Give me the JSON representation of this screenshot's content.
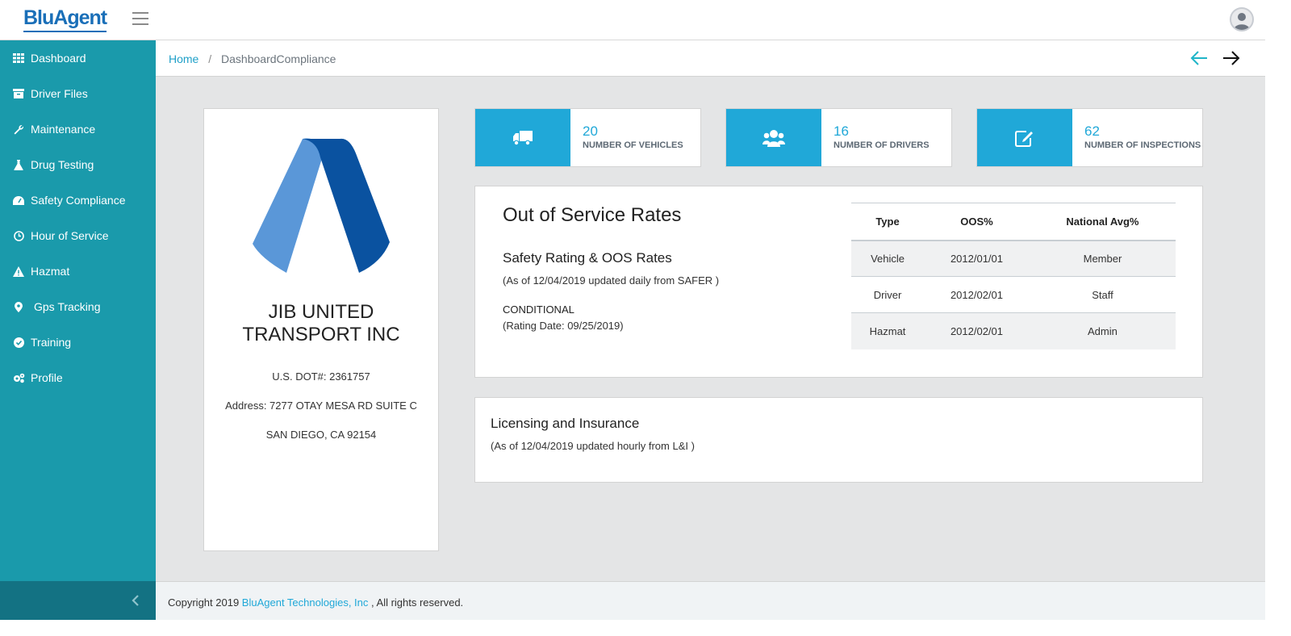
{
  "brand": {
    "logo_text": "BluAgent"
  },
  "sidebar": {
    "items": [
      {
        "label": "Dashboard",
        "icon": "grid-icon"
      },
      {
        "label": "Driver Files",
        "icon": "archive-icon"
      },
      {
        "label": "Maintenance",
        "icon": "wrench-icon"
      },
      {
        "label": "Drug Testing",
        "icon": "flask-icon"
      },
      {
        "label": "Safety Compliance",
        "icon": "gauge-icon"
      },
      {
        "label": "Hour of Service",
        "icon": "clock-icon"
      },
      {
        "label": "Hazmat",
        "icon": "warning-icon"
      },
      {
        "label": "Gps Tracking",
        "icon": "map-pin-icon"
      },
      {
        "label": "Training",
        "icon": "check-circle-icon"
      },
      {
        "label": "Profile",
        "icon": "cogs-icon"
      }
    ]
  },
  "breadcrumb": {
    "home": "Home",
    "separator": "/",
    "current": "DashboardCompliance"
  },
  "company": {
    "name_line1": "JIB UNITED",
    "name_line2": "TRANSPORT INC",
    "dot": "U.S. DOT#: 2361757",
    "address": "Address: 7277 OTAY MESA RD SUITE C",
    "city": "SAN DIEGO, CA 92154"
  },
  "stats": [
    {
      "value": "20",
      "label": "NUMBER OF VEHICLES",
      "icon": "truck-icon"
    },
    {
      "value": "16",
      "label": "NUMBER OF DRIVERS",
      "icon": "users-icon"
    },
    {
      "value": "62",
      "label": "NUMBER OF INSPECTIONS",
      "icon": "edit-icon"
    }
  ],
  "oos": {
    "title": "Out of Service Rates",
    "subtitle": "Safety Rating & OOS Rates",
    "note": "(As of 12/04/2019 updated daily from SAFER )",
    "rating": "CONDITIONAL",
    "rating_date": "(Rating Date: 09/25/2019)",
    "columns": [
      "Type",
      "OOS%",
      "National Avg%"
    ],
    "rows": [
      [
        "Vehicle",
        "2012/01/01",
        "Member"
      ],
      [
        "Driver",
        "2012/02/01",
        "Staff"
      ],
      [
        "Hazmat",
        "2012/02/01",
        "Admin"
      ]
    ]
  },
  "licensing": {
    "title": "Licensing and Insurance",
    "note": "(As of 12/04/2019 updated hourly from L&I )"
  },
  "footer": {
    "prefix": "Copyright 2019",
    "link": "BluAgent Technologies, Inc",
    "suffix": ", All rights reserved."
  },
  "colors": {
    "sidebar": "#1a9aab",
    "sidebar_footer": "#137283",
    "accent": "#20a8d8",
    "logo_light": "#5a97d8",
    "logo_dark": "#0a52a0"
  }
}
